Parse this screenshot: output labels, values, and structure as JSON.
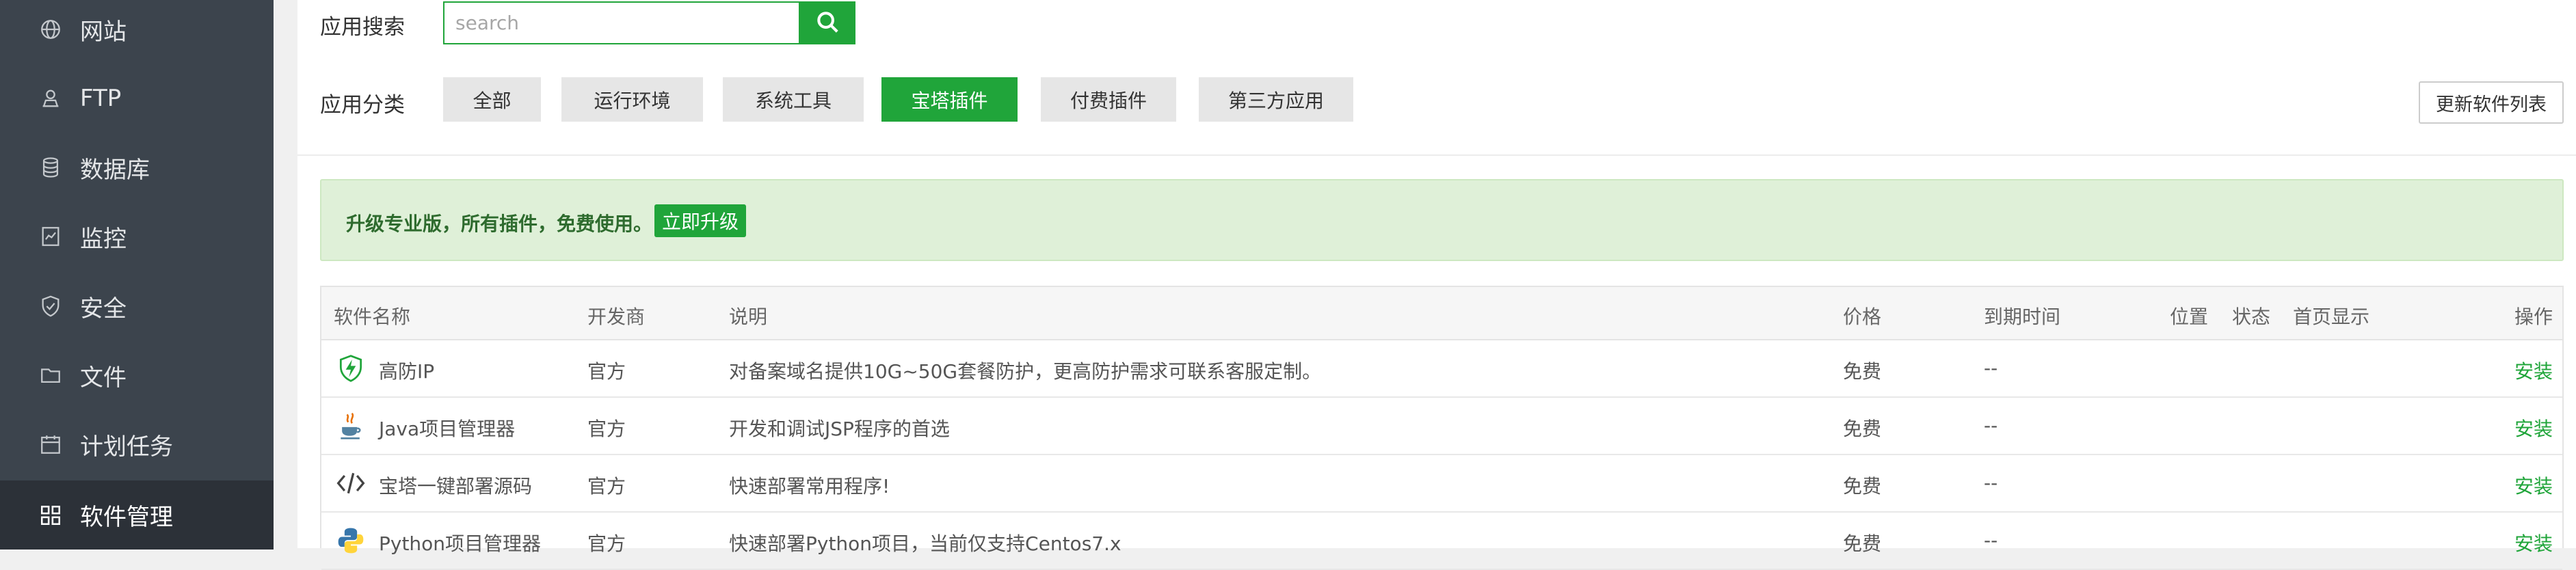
{
  "sidebar": {
    "items": [
      {
        "label": "网站",
        "icon": "globe-icon"
      },
      {
        "label": "FTP",
        "icon": "ftp-icon"
      },
      {
        "label": "数据库",
        "icon": "database-icon"
      },
      {
        "label": "监控",
        "icon": "monitor-icon"
      },
      {
        "label": "安全",
        "icon": "shield-icon"
      },
      {
        "label": "文件",
        "icon": "folder-icon"
      },
      {
        "label": "计划任务",
        "icon": "calendar-icon"
      },
      {
        "label": "软件管理",
        "icon": "grid-icon",
        "active": true
      }
    ]
  },
  "search": {
    "label": "应用搜索",
    "placeholder": "search"
  },
  "categories": {
    "label": "应用分类",
    "items": [
      "全部",
      "运行环境",
      "系统工具",
      "宝塔插件",
      "付费插件",
      "第三方应用"
    ],
    "active": "宝塔插件"
  },
  "update_list_button": "更新软件列表",
  "promo": {
    "text": "升级专业版，所有插件，免费使用。",
    "button": "立即升级"
  },
  "table": {
    "headers": {
      "name": "软件名称",
      "developer": "开发商",
      "description": "说明",
      "price": "价格",
      "expiry": "到期时间",
      "location": "位置",
      "status": "状态",
      "homepage": "首页显示",
      "actions": "操作"
    },
    "rows": [
      {
        "icon": "lightning-shield-icon",
        "name": "高防IP",
        "developer": "官方",
        "description": "对备案域名提供10G~50G套餐防护，更高防护需求可联系客服定制。",
        "price": "免费",
        "expiry": "--",
        "action": "安装"
      },
      {
        "icon": "java-icon",
        "name": "Java项目管理器",
        "developer": "官方",
        "description": "开发和调试JSP程序的首选",
        "price": "免费",
        "expiry": "--",
        "action": "安装"
      },
      {
        "icon": "code-icon",
        "name": "宝塔一键部署源码",
        "developer": "官方",
        "description": "快速部署常用程序!",
        "price": "免费",
        "expiry": "--",
        "action": "安装"
      },
      {
        "icon": "python-icon",
        "name": "Python项目管理器",
        "developer": "官方",
        "description": "快速部署Python项目，当前仅支持Centos7.x",
        "price": "免费",
        "expiry": "--",
        "action": "安装"
      }
    ]
  },
  "colors": {
    "sidebar_bg": "#3c444d",
    "sidebar_active_bg": "#2c3138",
    "accent_green": "#20a53a",
    "promo_bg": "#dff0d8"
  }
}
